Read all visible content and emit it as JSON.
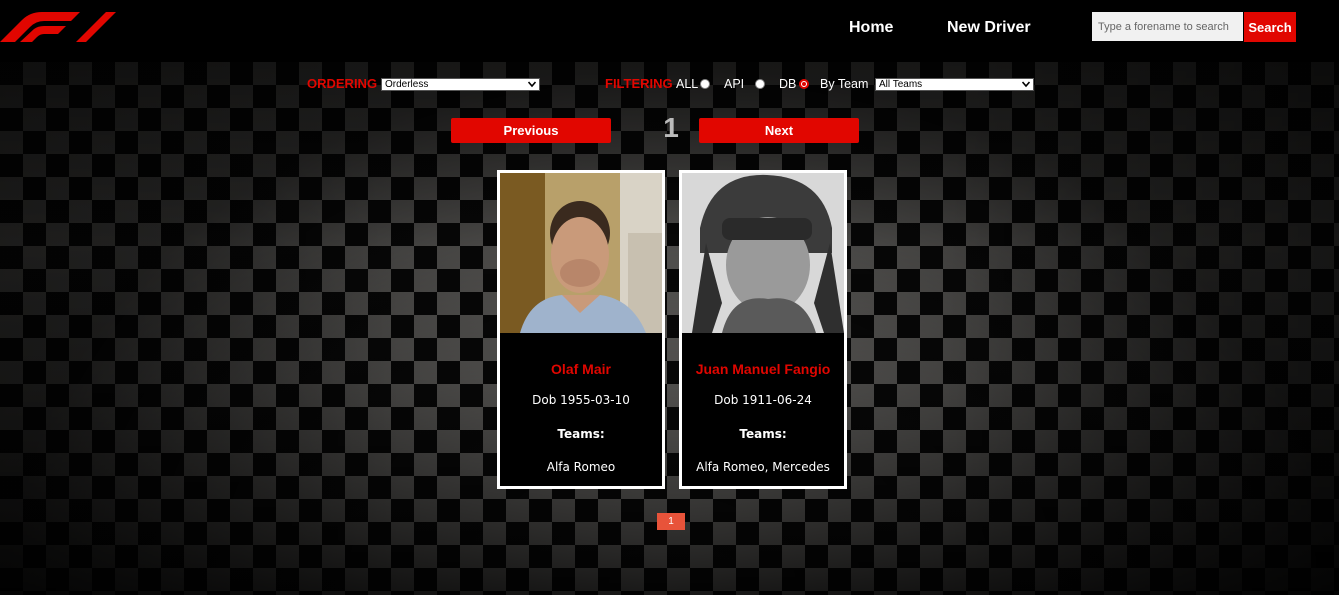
{
  "header": {
    "nav": [
      {
        "label": "Home"
      },
      {
        "label": "New Driver"
      }
    ],
    "search": {
      "placeholder": "Type a forename to search",
      "value": "",
      "button_label": "Search"
    }
  },
  "controls": {
    "ordering_label": "ORDERING",
    "ordering_selected": "Orderless",
    "filtering_label": "FILTERING",
    "radios": [
      {
        "label": "ALL",
        "checked": false
      },
      {
        "label": "API",
        "checked": false
      },
      {
        "label": "DB",
        "checked": true
      }
    ],
    "by_team_label": "By Team",
    "team_selected": "All Teams"
  },
  "pager": {
    "previous_label": "Previous",
    "next_label": "Next",
    "current_page": "1"
  },
  "drivers": [
    {
      "name": "Olaf Mair",
      "dob": "Dob 1955-03-10",
      "teams_label": "Teams:",
      "teams": "Alfa Romeo"
    },
    {
      "name": "Juan Manuel Fangio",
      "dob": "Dob 1911-06-24",
      "teams_label": "Teams:",
      "teams": "Alfa Romeo, Mercedes"
    }
  ],
  "pagination": {
    "pages": [
      "1"
    ]
  },
  "colors": {
    "accent": "#e10600",
    "header_bg": "#000000",
    "page_badge": "#e8533a"
  },
  "icons": [
    "f1-logo",
    "chevron-down-icon"
  ]
}
